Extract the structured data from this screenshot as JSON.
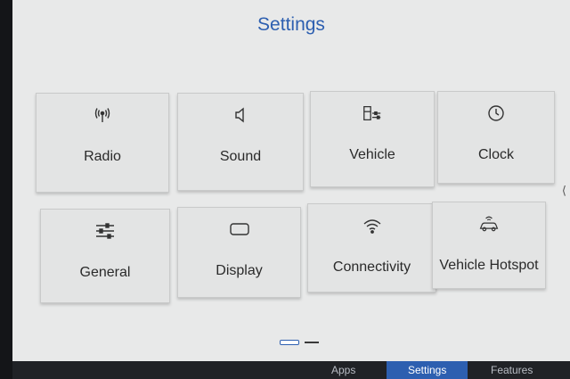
{
  "header": {
    "title": "Settings"
  },
  "tiles": [
    {
      "label": "Radio",
      "icon": "radio-antenna-icon"
    },
    {
      "label": "Sound",
      "icon": "speaker-icon"
    },
    {
      "label": "Vehicle",
      "icon": "vehicle-settings-icon"
    },
    {
      "label": "Clock",
      "icon": "clock-icon"
    },
    {
      "label": "General",
      "icon": "sliders-icon"
    },
    {
      "label": "Display",
      "icon": "display-icon"
    },
    {
      "label": "Connectivity",
      "icon": "wifi-icon"
    },
    {
      "label": "Vehicle Hotspot",
      "icon": "car-hotspot-icon"
    }
  ],
  "pager": {
    "pages": 2,
    "current": 1
  },
  "bottom_nav": {
    "items": [
      {
        "label": "Apps"
      },
      {
        "label": "Settings"
      },
      {
        "label": "Features"
      }
    ],
    "active": "Settings"
  },
  "colors": {
    "accent": "#2d5fb0",
    "background": "#e8e9e9",
    "tile": "#e3e4e4"
  }
}
